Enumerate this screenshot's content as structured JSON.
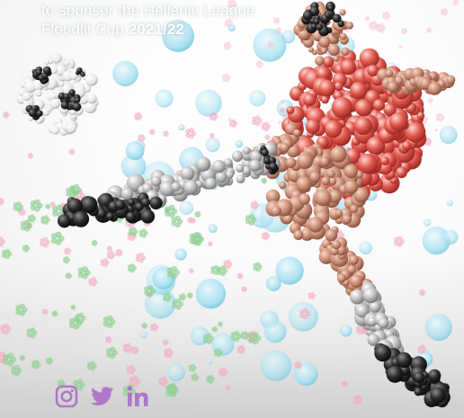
{
  "header": {
    "line1": "to sponsor the Hellenic League",
    "line2_text": "Floodlit Cup",
    "line2_season": "2021/22"
  },
  "social": {
    "color": "#b077c9",
    "icons": [
      "instagram-icon",
      "twitter-icon",
      "linkedin-icon"
    ],
    "linkedin_text": "in"
  },
  "palette": {
    "player_red": "#d6453f",
    "player_skin": "#c2806a",
    "ball_dark": "#222222",
    "bubble_blue": "#9dd9ec",
    "bubble_pink": "#f2a8bd",
    "bubble_green": "#8fcf92"
  }
}
